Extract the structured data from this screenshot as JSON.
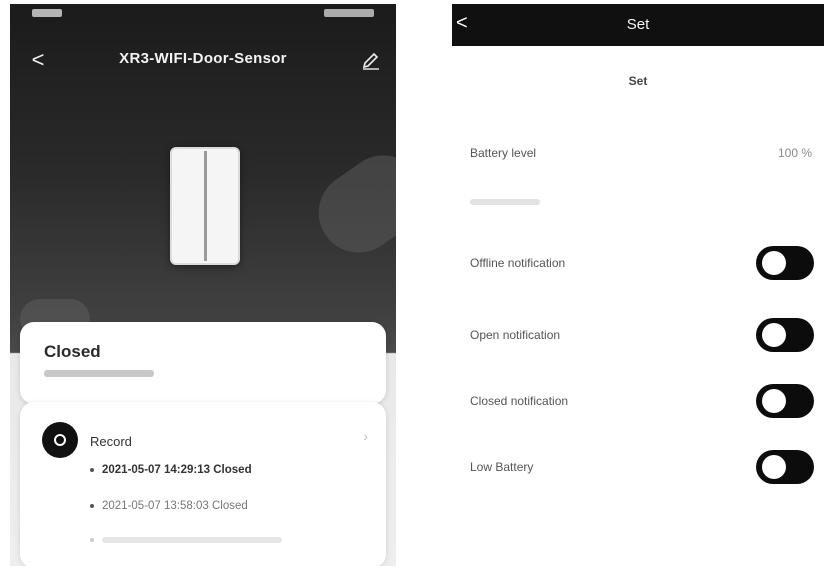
{
  "left_screen": {
    "title": "XR3-WIFI-Door-Sensor",
    "back_label": "<",
    "state": {
      "status": "Closed"
    },
    "record": {
      "label": "Record",
      "items": [
        "2021-05-07 14:29:13 Closed",
        "2021-05-07 13:58:03 Closed"
      ]
    }
  },
  "right_screen": {
    "header_title": "Set",
    "back_label": "<",
    "subtitle": "Set",
    "battery": {
      "label": "Battery level",
      "value": "100 %"
    },
    "toggles": [
      {
        "label": "Offline notification",
        "on": true
      },
      {
        "label": "Open notification",
        "on": true
      },
      {
        "label": "Closed notification",
        "on": true
      },
      {
        "label": "Low Battery",
        "on": true
      }
    ]
  },
  "colors": {
    "dark_header": "#101010",
    "toggle_on": "#0c0c0c",
    "card_bg": "#ffffff"
  }
}
